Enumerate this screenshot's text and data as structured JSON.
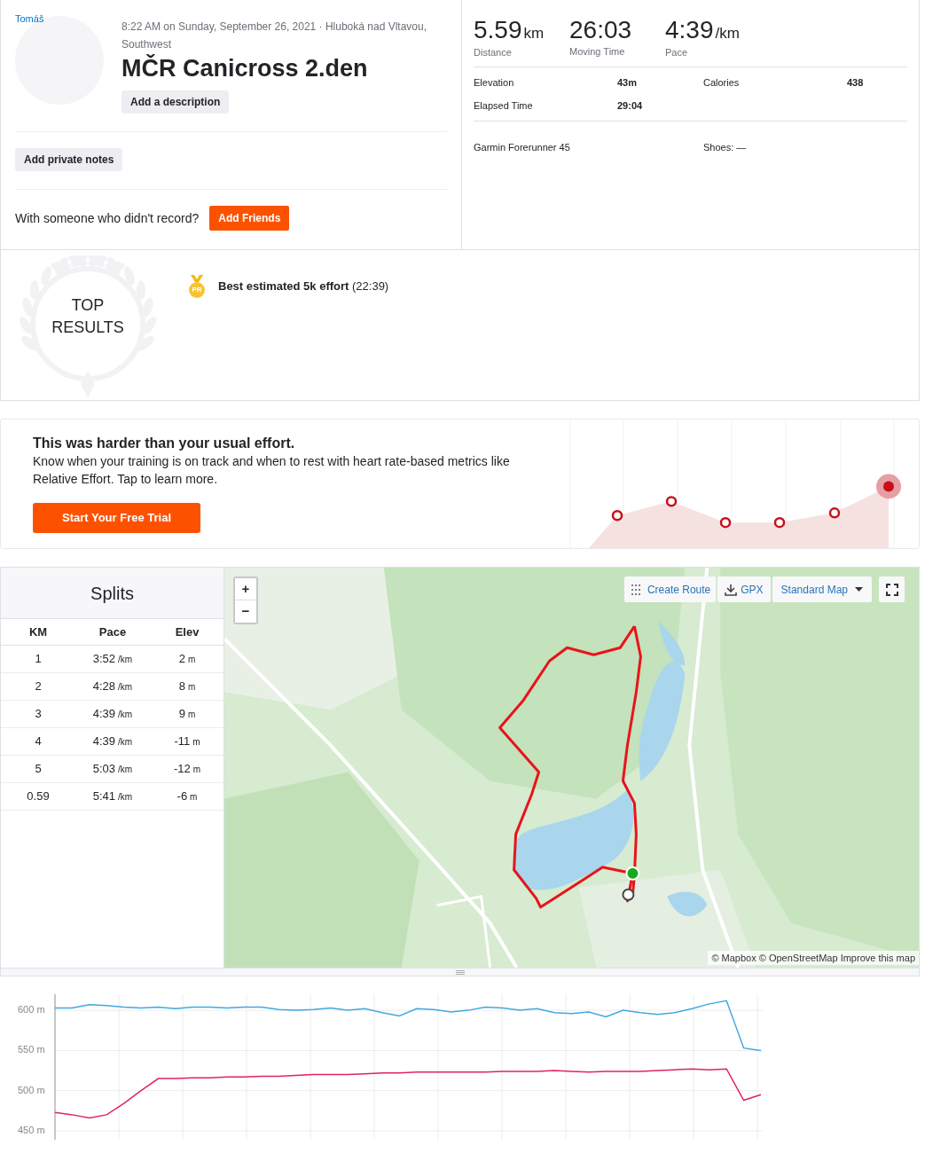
{
  "athlete": {
    "name": "Tomáš"
  },
  "activity": {
    "meta": "8:22 AM on Sunday, September 26, 2021 · Hluboká nad Vltavou, Southwest",
    "title": "MČR Canicross 2.den",
    "description_button": "Add a description"
  },
  "private_notes_button": "Add private notes",
  "friends": {
    "prompt": "With someone who didn't record?",
    "button": "Add Friends"
  },
  "stats": {
    "primary": [
      {
        "value": "5.59",
        "unit": "km",
        "label": "Distance"
      },
      {
        "value": "26:03",
        "label": "Moving Time"
      },
      {
        "value": "4:39",
        "unit": "/km",
        "label": "Pace"
      }
    ],
    "secondary": [
      {
        "label": "Elevation",
        "value": "43m"
      },
      {
        "label": "Calories",
        "value": "438"
      },
      {
        "label": "Elapsed Time",
        "value": "29:04"
      }
    ],
    "device": "Garmin Forerunner 45",
    "shoes": "Shoes: —"
  },
  "top_results": {
    "title": "TOP RESULTS",
    "achievements": [
      {
        "badge": "PR",
        "text": "**Best estimated 5k effort** (22:39)"
      }
    ]
  },
  "relative_effort": {
    "title": "This was harder than your usual effort.",
    "body": "Know when your training is on track and when to rest with heart rate-based metrics like Relative Effort. Tap to learn more.",
    "button": "Start Your Free Trial"
  },
  "splits": {
    "title": "Splits",
    "columns": [
      "KM",
      "Pace",
      "Elev"
    ],
    "rows": [
      {
        "km": "1",
        "pace": "3:52",
        "pace_unit": "/km",
        "elev": "2",
        "elev_unit": "m"
      },
      {
        "km": "2",
        "pace": "4:28",
        "pace_unit": "/km",
        "elev": "8",
        "elev_unit": "m"
      },
      {
        "km": "3",
        "pace": "4:39",
        "pace_unit": "/km",
        "elev": "9",
        "elev_unit": "m"
      },
      {
        "km": "4",
        "pace": "4:39",
        "pace_unit": "/km",
        "elev": "-11",
        "elev_unit": "m"
      },
      {
        "km": "5",
        "pace": "5:03",
        "pace_unit": "/km",
        "elev": "-12",
        "elev_unit": "m"
      },
      {
        "km": "0.59",
        "pace": "5:41",
        "pace_unit": "/km",
        "elev": "-6",
        "elev_unit": "m"
      }
    ]
  },
  "map": {
    "zoom_in": "+",
    "zoom_out": "−",
    "create_route": "Create Route",
    "gpx": "GPX",
    "map_type": "Standard Map",
    "attribution": "© Mapbox © OpenStreetMap Improve this map"
  },
  "chart": {
    "chart_data": {
      "type": "line",
      "grid": true,
      "ylim": [
        450,
        620
      ],
      "yticks": [
        {
          "value": 450,
          "label": "450 m"
        },
        {
          "value": 500,
          "label": "500 m"
        },
        {
          "value": 550,
          "label": "550 m"
        },
        {
          "value": 600,
          "label": "600 m"
        }
      ],
      "series": [
        {
          "color": "#3fa9e0",
          "values": [
            603,
            603,
            607,
            606,
            604,
            603,
            604,
            602,
            604,
            604,
            603,
            604,
            604,
            601,
            600,
            601,
            603,
            600,
            602,
            597,
            593,
            602,
            601,
            598,
            600,
            604,
            603,
            600,
            602,
            597,
            596,
            598,
            592,
            600,
            597,
            595,
            597,
            602,
            608,
            612,
            553,
            550
          ]
        },
        {
          "color": "#e0245e",
          "values": [
            473,
            470,
            466,
            470,
            484,
            500,
            515,
            515,
            516,
            516,
            517,
            517,
            518,
            518,
            519,
            520,
            520,
            520,
            521,
            522,
            522,
            523,
            523,
            523,
            523,
            523,
            524,
            524,
            524,
            525,
            524,
            523,
            524,
            524,
            524,
            525,
            526,
            527,
            526,
            527,
            488,
            495
          ]
        }
      ]
    }
  }
}
